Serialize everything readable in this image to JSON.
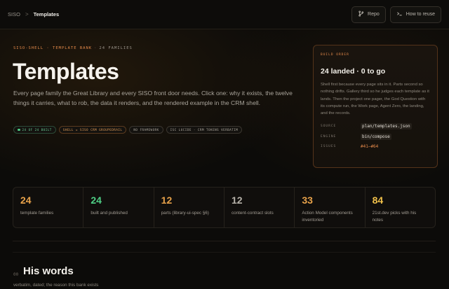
{
  "breadcrumb": {
    "root": "SISO",
    "separator": ">",
    "current": "Templates"
  },
  "topbar": {
    "repo_label": "Repo",
    "reuse_label": "How to reuse"
  },
  "header": {
    "eyebrow_a": "SISO-SHELL · TEMPLATE BANK",
    "eyebrow_dot": "·",
    "eyebrow_count": "24 FAMILIES",
    "title": "Templates",
    "description": "Every page family the Great Library and every SISO front door needs. Click one: why it exists, the twelve things it carries, what to rob, the data it renders, and the rendered example in the CRM shell.",
    "tags": [
      "24 OF 24 BUILT",
      "SHELL = SISO CRM GROUPEDRAIL",
      "NO FRAMEWORK",
      "ISC LUCIDE · CRM TOKENS VERBATIM"
    ]
  },
  "build_order": {
    "label": "BUILD ORDER",
    "title": "24 landed · 0 to go",
    "body": "Shell first because every page sits in it. Parts second so nothing drifts. Gallery third so he judges each template as it lands. Then the project one pager, the God Question with its compute run, the Work page, Agent Zero, the landing, and the records.",
    "rows": [
      {
        "key": "SOURCE",
        "value": "plan/templates.json"
      },
      {
        "key": "ENGINE",
        "value": "bin/compose"
      },
      {
        "key": "ISSUES",
        "value": "#41–#64"
      }
    ]
  },
  "stats": [
    {
      "value": "24",
      "label": "template families",
      "color": "#e8a24a"
    },
    {
      "value": "24",
      "label": "built and published",
      "color": "#4fcf86"
    },
    {
      "value": "12",
      "label": "parts (library-ui-spec §6)",
      "color": "#e8a24a"
    },
    {
      "value": "12",
      "label": "content-contract slots",
      "color": "#b7b2aa"
    },
    {
      "value": "33",
      "label": "Action Model components inventoried",
      "color": "#e8a24a"
    },
    {
      "value": "84",
      "label": "21st.dev picks with his notes",
      "color": "#f0c04a"
    }
  ],
  "section": {
    "number": "00",
    "title": "His words",
    "subtitle": "verbatim, dated; the reason this bank exists"
  },
  "colors": {
    "accent": "#e48a4a",
    "green": "#4fcf86",
    "bg": "#0c0b09"
  },
  "icons": {
    "repo": "git-branch-icon",
    "reuse": "terminal-icon"
  }
}
